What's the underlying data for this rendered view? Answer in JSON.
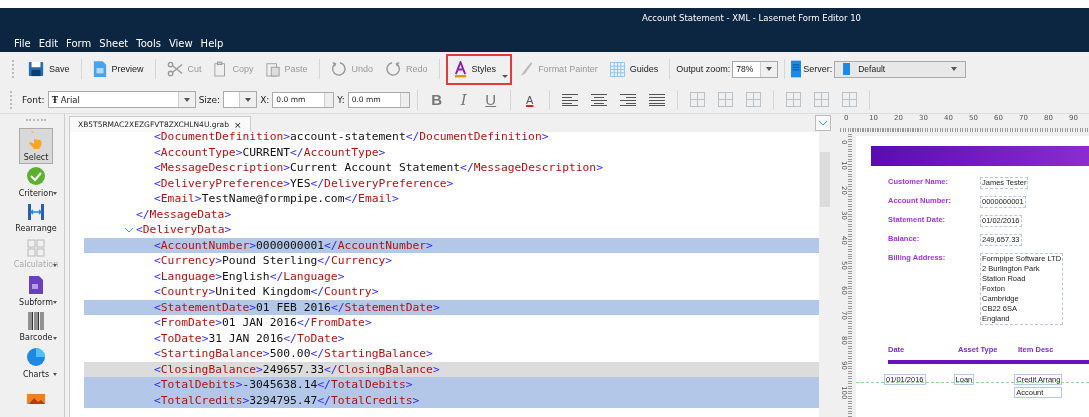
{
  "window": {
    "title": "Account Statement - XML - Lasernet Form Editor 10"
  },
  "menu": [
    "File",
    "Edit",
    "Form",
    "Sheet",
    "Tools",
    "View",
    "Help"
  ],
  "toolbar_groups": [
    [
      {
        "kind": "save",
        "label": "Save",
        "disabled": false,
        "highlighted": false,
        "dropdown": false
      }
    ],
    [
      {
        "kind": "preview",
        "label": "Preview",
        "disabled": false,
        "highlighted": false,
        "dropdown": false
      }
    ],
    [
      {
        "kind": "cut",
        "label": "Cut",
        "disabled": true,
        "highlighted": false,
        "dropdown": false
      },
      {
        "kind": "copy",
        "label": "Copy",
        "disabled": true,
        "highlighted": false,
        "dropdown": false
      },
      {
        "kind": "paste",
        "label": "Paste",
        "disabled": true,
        "highlighted": false,
        "dropdown": false
      }
    ],
    [
      {
        "kind": "undo",
        "label": "Undo",
        "disabled": true,
        "highlighted": false,
        "dropdown": false
      },
      {
        "kind": "redo",
        "label": "Redo",
        "disabled": true,
        "highlighted": false,
        "dropdown": false
      }
    ],
    [
      {
        "kind": "styles",
        "label": "Styles",
        "disabled": false,
        "highlighted": true,
        "dropdown": true
      },
      {
        "kind": "painter",
        "label": "Format Painter",
        "disabled": true,
        "highlighted": false,
        "dropdown": false
      },
      {
        "kind": "guides",
        "label": "Guides",
        "disabled": false,
        "highlighted": false,
        "dropdown": false
      }
    ]
  ],
  "output_zoom": {
    "label": "Output zoom:",
    "value": "78%"
  },
  "server": {
    "label": "Server:",
    "value": "Default"
  },
  "format_bar": {
    "font_label": "Font:",
    "font_value": "Arial",
    "font_glyph": "Ŧ",
    "size_label": "Size:",
    "x_label": "X:",
    "x_value": "0.0 mm",
    "y_label": "Y:",
    "y_value": "0.0 mm",
    "bold": "B",
    "italic": "I",
    "underline": "U",
    "color_letter": "A"
  },
  "palette": [
    {
      "kind": "select",
      "label": "Select",
      "selected": true,
      "disabled": false,
      "dropdown": false
    },
    {
      "kind": "criterion",
      "label": "Criterion",
      "selected": false,
      "disabled": false,
      "dropdown": true
    },
    {
      "kind": "rearrange",
      "label": "Rearrange",
      "selected": false,
      "disabled": false,
      "dropdown": false
    },
    {
      "kind": "calculation",
      "label": "Calculation",
      "selected": false,
      "disabled": true,
      "dropdown": true
    },
    {
      "kind": "subform",
      "label": "Subform",
      "selected": false,
      "disabled": false,
      "dropdown": true
    },
    {
      "kind": "barcode",
      "label": "Barcode",
      "selected": false,
      "disabled": false,
      "dropdown": true
    },
    {
      "kind": "charts",
      "label": "Charts",
      "selected": false,
      "disabled": false,
      "dropdown": true
    },
    {
      "kind": "image",
      "selected": false,
      "disabled": false,
      "dropdown": false
    }
  ],
  "editor_tab": {
    "label": "XB5T5RMAC2XEZGFVT8ZXCHLN4U.grab",
    "close": "×",
    "selected": true
  },
  "code_tree": [
    {
      "close": "</MessageData>",
      "selected": false,
      "current": false,
      "children": [
        {
          "open": "<DocumentDefinition>",
          "value": "account-statement",
          "close": "</DocumentDefinition>",
          "selected": false,
          "current": false
        },
        {
          "open": "<AccountType>",
          "value": "CURRENT",
          "close": "</AccountType>",
          "selected": false,
          "current": false
        },
        {
          "open": "<MessageDescription>",
          "value": "Current Account Statement",
          "close": "</MessageDescription>",
          "selected": false,
          "current": false
        },
        {
          "open": "<DeliveryPreference>",
          "value": "YES",
          "close": "</DeliveryPreference>",
          "selected": false,
          "current": false
        },
        {
          "open": "<Email>",
          "value": "TestName@formpipe.com",
          "close": "</Email>",
          "selected": false,
          "current": false
        }
      ]
    },
    {
      "open": "<DeliveryData>",
      "expanded": true,
      "selected": false,
      "current": false,
      "children": [
        {
          "open": "<AccountNumber>",
          "value": "0000000001",
          "close": "</AccountNumber>",
          "selected": true,
          "current": false
        },
        {
          "open": "<Currency>",
          "value": "Pound Sterling",
          "close": "</Currency>",
          "selected": false,
          "current": false
        },
        {
          "open": "<Language>",
          "value": "English",
          "close": "</Language>",
          "selected": false,
          "current": false
        },
        {
          "open": "<Country>",
          "value": "United Kingdom",
          "close": "</Country>",
          "selected": false,
          "current": false
        },
        {
          "open": "<StatementDate>",
          "value": "01 FEB 2016",
          "close": "</StatementDate>",
          "selected": true,
          "current": false
        },
        {
          "open": "<FromDate>",
          "value": "01 JAN 2016",
          "close": "</FromDate>",
          "selected": false,
          "current": false
        },
        {
          "open": "<ToDate>",
          "value": "31 JAN 2016",
          "close": "</ToDate>",
          "selected": false,
          "current": false
        },
        {
          "open": "<StartingBalance>",
          "value": "500.00",
          "close": "</StartingBalance>",
          "selected": false,
          "current": false
        },
        {
          "open": "<ClosingBalance>",
          "value": "249657.33",
          "close": "</ClosingBalance>",
          "selected": false,
          "current": true
        },
        {
          "open": "<TotalDebits>",
          "value": "-3045638.14",
          "close": "</TotalDebits>",
          "selected": true,
          "current": false
        },
        {
          "open": "<TotalCredits>",
          "value": "3294795.47",
          "close": "</TotalCredits>",
          "selected": true,
          "current": false
        }
      ]
    }
  ],
  "ruler": {
    "horizontal": [
      "0",
      "10",
      "20",
      "30",
      "40",
      "50",
      "60",
      "70",
      "80",
      "90"
    ],
    "vertical": [
      "0",
      "10",
      "20",
      "30",
      "40",
      "50",
      "60",
      "70",
      "80",
      "90",
      "100"
    ]
  },
  "form": {
    "fields": [
      {
        "label": "Customer Name:",
        "lines": [
          "James Tester"
        ]
      },
      {
        "label": "Account Number:",
        "lines": [
          "0000000001"
        ]
      },
      {
        "label": "Statement Date:",
        "lines": [
          "01/02/2016"
        ]
      },
      {
        "label": "Balance:",
        "lines": [
          "249,657.33"
        ]
      },
      {
        "label": "Billing Address:",
        "lines": [
          "Formpipe Software LTD",
          "2 Burlington Park",
          "Station Road",
          "Foxton",
          "Cambridge",
          "CB22 6SA",
          "England"
        ]
      }
    ],
    "table_columns": [
      "Date",
      "Asset Type",
      "Item Desc"
    ],
    "table_rows": [
      {
        "date": "01/01/2016",
        "asset_type": "Loan",
        "item_description": [
          "Credit Arrang",
          "Account"
        ]
      }
    ]
  }
}
